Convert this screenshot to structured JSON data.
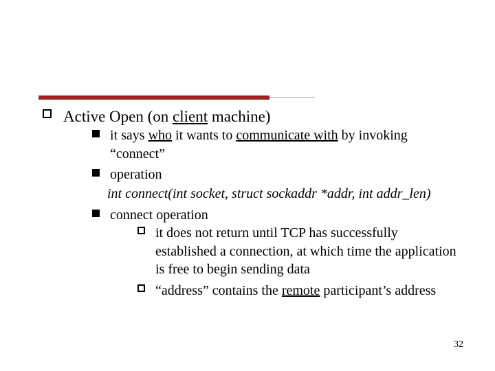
{
  "page_number": "32",
  "top": {
    "title_pre": "Active Open (on ",
    "title_u": "client",
    "title_post": " machine)"
  },
  "b1": {
    "pre": "it says ",
    "u1": "who",
    "mid": " it wants to ",
    "u2": "communicate with",
    "post": " by invoking “connect”"
  },
  "b2": {
    "text": "operation"
  },
  "code": "int connect(int socket, struct sockaddr *addr, int addr_len)",
  "b3": {
    "text": "connect operation"
  },
  "c1": {
    "text": "it does not return until TCP has successfully established a connection, at which time the application is free to begin sending data"
  },
  "c2": {
    "pre": "“address” contains the ",
    "u": "remote",
    "post": " participant’s address"
  }
}
